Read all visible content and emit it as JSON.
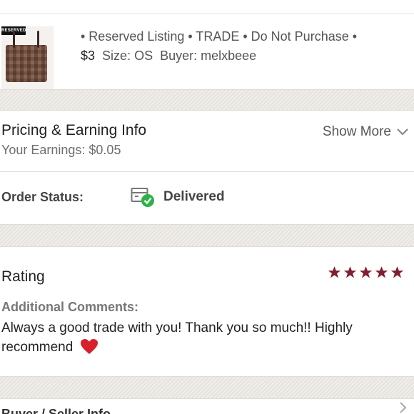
{
  "listing": {
    "thumbnail_tag": "RESERVED",
    "line1": "• Reserved Listing • TRADE • Do Not Purchase •",
    "price": "$3",
    "size": "Size: OS",
    "buyer": "Buyer: melxbeee"
  },
  "pricing": {
    "title": "Pricing & Earning Info",
    "earnings": "Your Earnings: $0.05",
    "show_more": "Show More"
  },
  "order_status": {
    "label": "Order Status:",
    "value": "Delivered",
    "status_color": "#2bb34a"
  },
  "rating": {
    "title": "Rating",
    "stars": 5,
    "star_color": "#7f1f2f",
    "comments_label": "Additional Comments:",
    "comment": "Always a good trade with you! Thank you so much!! Highly recommend"
  },
  "next_section": {
    "label": "Buyer / Seller Info"
  },
  "icons": [
    "box-delivered-icon",
    "chevron-down-icon",
    "star-icon",
    "heart-icon",
    "chevron-right-icon"
  ]
}
